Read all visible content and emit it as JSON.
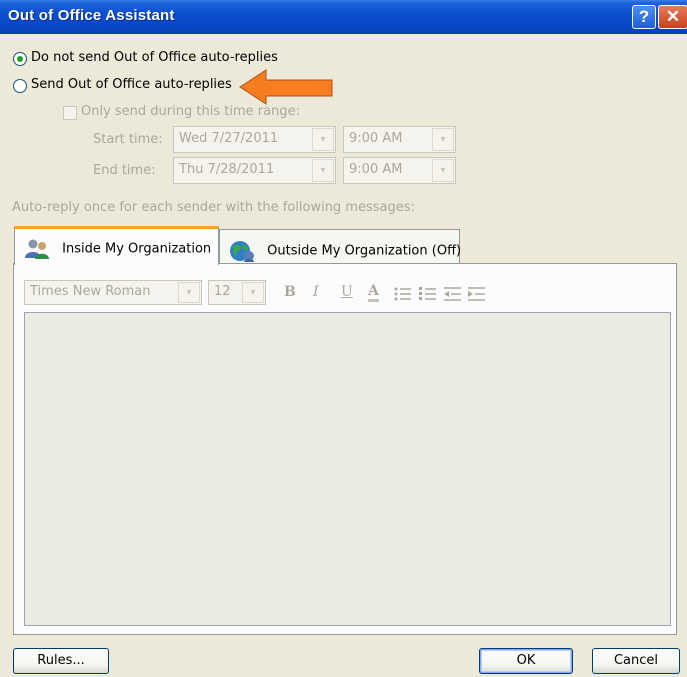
{
  "window": {
    "title": "Out of Office Assistant",
    "help_glyph": "?",
    "close_glyph": "✕"
  },
  "options": {
    "no_send_label": "Do not send Out of Office auto-replies",
    "send_label": "Send Out of Office auto-replies",
    "selected": "no_send",
    "time_range_label": "Only send during this time range:",
    "start_label": "Start time:",
    "start_date": "Wed 7/27/2011",
    "start_time": "9:00 AM",
    "end_label": "End time:",
    "end_date": "Thu 7/28/2011",
    "end_time": "9:00 AM"
  },
  "messages_label": "Auto-reply once for each sender with the following messages:",
  "tabs": [
    {
      "label": "Inside My Organization",
      "icon": "people-icon",
      "active": true
    },
    {
      "label": "Outside My Organization (Off)",
      "icon": "globe-icon",
      "active": false
    }
  ],
  "toolbar": {
    "font": "Times New Roman",
    "size": "12",
    "dropdown_glyph": "▾"
  },
  "footer": {
    "rules_label": "Rules...",
    "ok_label": "OK",
    "cancel_label": "Cancel"
  },
  "colors": {
    "titlebar": "#0a4fd1",
    "tab_accent": "#f7a629",
    "arrow": "#f57d1f",
    "selected_radio": "#21a121"
  }
}
